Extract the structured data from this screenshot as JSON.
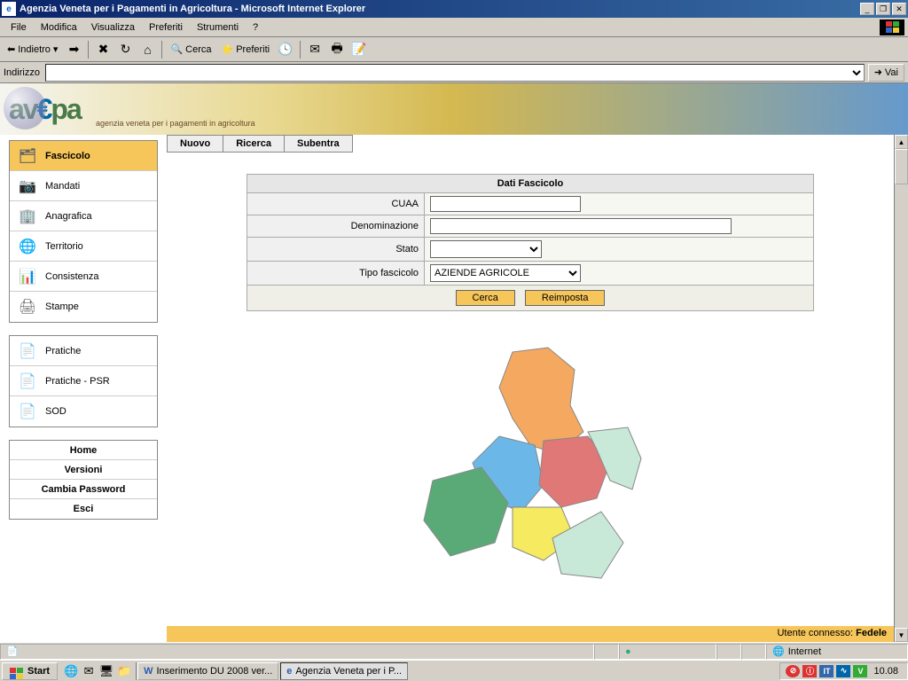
{
  "window": {
    "title": "Agenzia Veneta per i Pagamenti in Agricoltura - Microsoft Internet Explorer"
  },
  "menu": {
    "file": "File",
    "modifica": "Modifica",
    "visualizza": "Visualizza",
    "preferiti": "Preferiti",
    "strumenti": "Strumenti",
    "help": "?"
  },
  "toolbar": {
    "indietro": "Indietro",
    "cerca": "Cerca",
    "preferiti": "Preferiti"
  },
  "address": {
    "label": "Indirizzo",
    "value": "",
    "go": "Vai"
  },
  "banner": {
    "logo_a": "av",
    "logo_e": "€",
    "logo_b": "pa",
    "tagline": "agenzia veneta per i pagamenti in agricoltura"
  },
  "tabs": {
    "nuovo": "Nuovo",
    "ricerca": "Ricerca",
    "subentra": "Subentra"
  },
  "sidebar": {
    "group1": [
      {
        "label": "Fascicolo",
        "active": true
      },
      {
        "label": "Mandati"
      },
      {
        "label": "Anagrafica"
      },
      {
        "label": "Territorio"
      },
      {
        "label": "Consistenza"
      },
      {
        "label": "Stampe"
      }
    ],
    "group2": [
      {
        "label": "Pratiche"
      },
      {
        "label": "Pratiche - PSR"
      },
      {
        "label": "SOD"
      }
    ],
    "group3": [
      {
        "label": "Home"
      },
      {
        "label": "Versioni"
      },
      {
        "label": "Cambia Password"
      },
      {
        "label": "Esci"
      }
    ]
  },
  "form": {
    "title": "Dati Fascicolo",
    "cuaa_label": "CUAA",
    "cuaa_value": "",
    "denominazione_label": "Denominazione",
    "denominazione_value": "",
    "stato_label": "Stato",
    "stato_value": "",
    "tipo_label": "Tipo fascicolo",
    "tipo_value": "AZIENDE AGRICOLE",
    "cerca_btn": "Cerca",
    "reimposta_btn": "Reimposta"
  },
  "footer": {
    "utente_label": "Utente connesso:",
    "utente_name": "Fedele"
  },
  "iestatus": {
    "zone": "Internet"
  },
  "taskbar": {
    "start": "Start",
    "task1": "Inserimento DU 2008 ver...",
    "task2": "Agenzia Veneta per i P...",
    "tray_it": "IT",
    "clock": "10.08"
  }
}
